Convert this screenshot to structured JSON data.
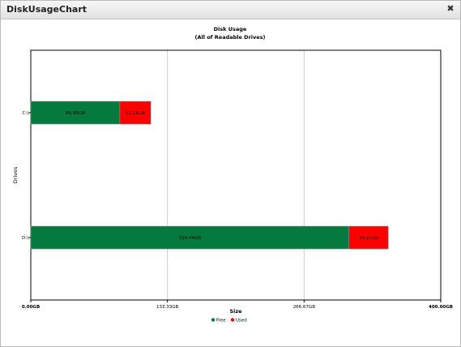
{
  "window": {
    "title": "DiskUsageChart",
    "close_glyph": "✖"
  },
  "chart_data": {
    "type": "bar",
    "orientation": "horizontal",
    "stacked": true,
    "title": "Disk Usage",
    "subtitle": "(All of Readable Drives)",
    "xlabel": "Size",
    "ylabel": "Drives",
    "categories": [
      "C:\\",
      "D:\\"
    ],
    "xlim": [
      0,
      400
    ],
    "x_ticks": [
      "0.00GB",
      "133.33GB",
      "266.67GB",
      "400.00GB"
    ],
    "series": [
      {
        "name": "Free",
        "color": "#047a3e",
        "values": [
          86.95,
          310.44
        ],
        "labels": [
          "86.95GB",
          "310.44GB"
        ]
      },
      {
        "name": "Used",
        "color": "#ff0000",
        "values": [
          30.15,
          38.27
        ],
        "labels": [
          "30.15GB",
          "38.27GB"
        ]
      }
    ],
    "grid": true,
    "legend_position": "bottom"
  }
}
